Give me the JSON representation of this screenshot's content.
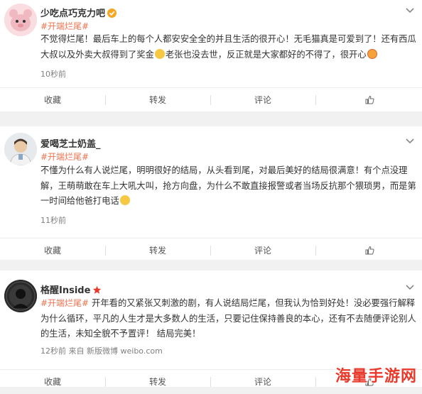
{
  "posts": [
    {
      "author": "少吃点巧克力吧",
      "topic": "#开端烂尾#",
      "text_a": "不觉得烂尾！最后车上的每个人都安安全全的并且生活的很开心！无毛猫真是可爱到了！还有西瓜大叔以及外卖大叔得到了奖金",
      "text_b": "老张也没去世，反正就是大家都好的不得了，很开心",
      "time": "10秒前",
      "source": "",
      "actions": {
        "fav": "收藏",
        "repost": "转发",
        "comment": "评论"
      }
    },
    {
      "author": "爱喝芝士奶盖_",
      "topic": "#开端烂尾#",
      "text_a": "不懂为什么有人说烂尾，明明很好的结局，从头看到尾，对最后美好的结局很满意！有个点没理解，王萌萌敢在车上大吼大叫，抢方向盘，为什么不敢直接报警或者当场反抗那个猥琐男，而是第一时间给他爸打电话",
      "text_b": "",
      "time": "11秒前",
      "source": "",
      "actions": {
        "fav": "收藏",
        "repost": "转发",
        "comment": "评论"
      }
    },
    {
      "author": "格醒Inside",
      "topic": "#开端烂尾#",
      "text_a": "开年看的又紧张又刺激的剧，有人说结局烂尾，但我认为恰到好处！没必要强行解释为什么循环，平凡的人生才是大多数人的生活，只要记住保持善良的本心，还有不去随便评论别人的生活，未知全貌不予置评！ 结局完美！",
      "text_b": "",
      "time": "12秒前",
      "source": "来自 新版微博 weibo.com",
      "actions": {
        "fav": "收藏",
        "repost": "转发",
        "comment": "评论"
      }
    }
  ],
  "watermark": "海量手游网",
  "colors": {
    "topic": "#eb7350",
    "badge_gold": "#f5a623",
    "badge_red": "#e8392b"
  }
}
